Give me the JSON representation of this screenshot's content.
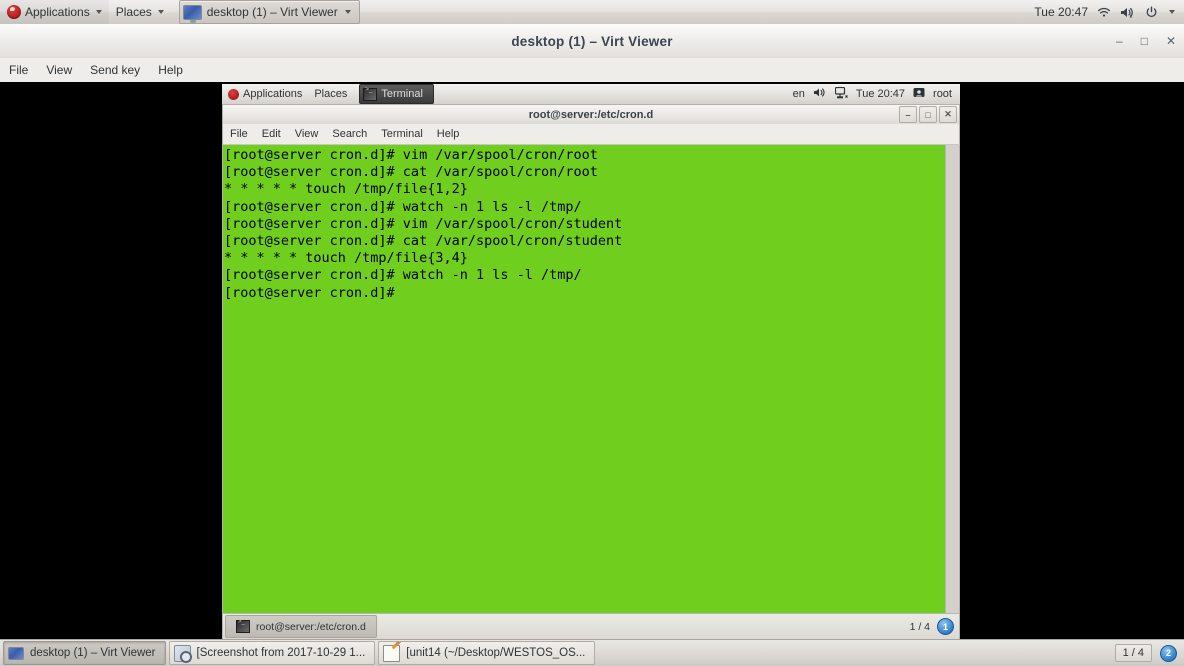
{
  "host_panel": {
    "menus": [
      {
        "label": "Applications",
        "icon": "fedora-logo-icon",
        "has_caret": true
      },
      {
        "label": "Places",
        "has_caret": true
      }
    ],
    "window_button": {
      "label": "desktop (1) – Virt Viewer",
      "icon": "monitor-icon",
      "has_caret": true
    },
    "tray": {
      "clock": "Tue 20:47",
      "icons": [
        "wifi-icon",
        "volume-muted-icon",
        "power-icon",
        "caret-down-icon"
      ]
    }
  },
  "virt_viewer": {
    "title": "desktop (1) – Virt Viewer",
    "window_buttons": {
      "minimize": "–",
      "maximize": "□",
      "close": "✕"
    },
    "menubar": [
      "File",
      "View",
      "Send key",
      "Help"
    ]
  },
  "guest": {
    "panel": {
      "menus": [
        {
          "label": "Applications",
          "icon": "fedora-logo-icon"
        },
        {
          "label": "Places"
        }
      ],
      "window_button": {
        "label": "Terminal",
        "icon": "terminal-icon"
      },
      "tray": {
        "keyboard_layout": "en",
        "clock": "Tue 20:47",
        "user": "root",
        "icons": [
          "volume-icon",
          "network-icon",
          "user-icon"
        ]
      }
    },
    "terminal": {
      "title": "root@server:/etc/cron.d",
      "window_buttons": {
        "minimize": "–",
        "maximize": "□",
        "close": "✕"
      },
      "menubar": [
        "File",
        "Edit",
        "View",
        "Search",
        "Terminal",
        "Help"
      ],
      "background_color": "#6FCE1E",
      "foreground_color": "#000000",
      "content": "[root@server cron.d]# vim /var/spool/cron/root\n[root@server cron.d]# cat /var/spool/cron/root\n* * * * * touch /tmp/file{1,2}\n[root@server cron.d]# watch -n 1 ls -l /tmp/\n[root@server cron.d]# vim /var/spool/cron/student\n[root@server cron.d]# cat /var/spool/cron/student\n* * * * * touch /tmp/file{3,4}\n[root@server cron.d]# watch -n 1 ls -l /tmp/\n[root@server cron.d]# ",
      "status_bar": {
        "tab_label": "root@server:/etc/cron.d",
        "workspace": "1 / 4",
        "badge": "1"
      }
    }
  },
  "host_taskbar": {
    "buttons": [
      {
        "label": "desktop (1) – Virt Viewer",
        "icon": "monitor-icon",
        "active": true
      },
      {
        "label": "[Screenshot from 2017-10-29 1...",
        "icon": "screenshot-icon",
        "active": false
      },
      {
        "label": "[unit14 (~/Desktop/WESTOS_OS...",
        "icon": "gedit-icon",
        "active": false
      }
    ],
    "workspace": "1 / 4",
    "badge": "2"
  }
}
